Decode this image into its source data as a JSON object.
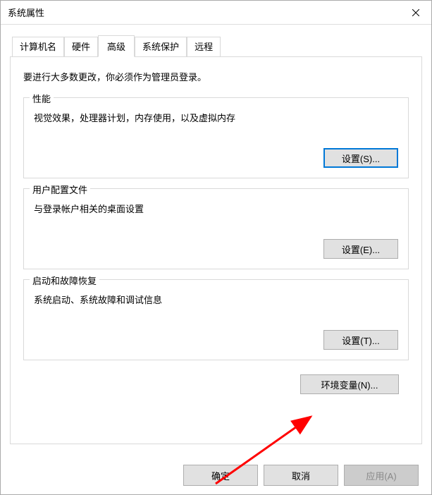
{
  "window": {
    "title": "系统属性"
  },
  "tabs": {
    "computer_name": "计算机名",
    "hardware": "硬件",
    "advanced": "高级",
    "system_protection": "系统保护",
    "remote": "远程"
  },
  "intro": "要进行大多数更改，你必须作为管理员登录。",
  "performance": {
    "legend": "性能",
    "desc": "视觉效果，处理器计划，内存使用，以及虚拟内存",
    "button": "设置(S)..."
  },
  "profile": {
    "legend": "用户配置文件",
    "desc": "与登录帐户相关的桌面设置",
    "button": "设置(E)..."
  },
  "startup": {
    "legend": "启动和故障恢复",
    "desc": "系统启动、系统故障和调试信息",
    "button": "设置(T)..."
  },
  "env_vars": {
    "button": "环境变量(N)..."
  },
  "dialog_buttons": {
    "ok": "确定",
    "cancel": "取消",
    "apply": "应用(A)"
  }
}
